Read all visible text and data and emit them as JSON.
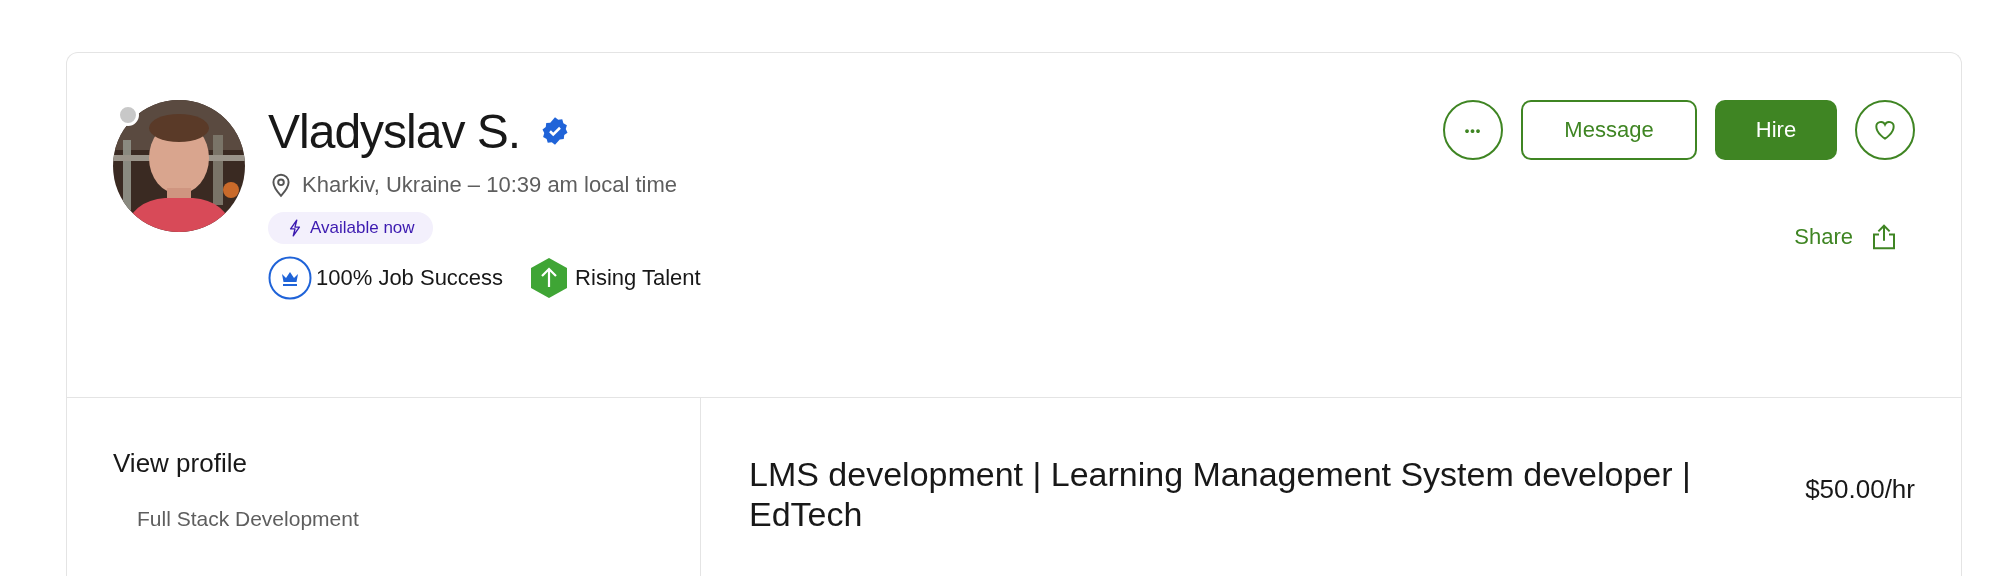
{
  "profile": {
    "name": "Vladyslav S.",
    "verified": true,
    "online": false,
    "location": "Kharkiv, Ukraine – 10:39 am local time",
    "availability": "Available now",
    "badges": [
      {
        "kind": "job_success",
        "label": "100% Job Success"
      },
      {
        "kind": "rising_talent",
        "label": "Rising Talent"
      }
    ]
  },
  "actions": {
    "more_label": "•••",
    "message": "Message",
    "hire": "Hire",
    "saved": false,
    "share": "Share"
  },
  "sidebar": {
    "title": "View profile",
    "items": [
      "Full Stack Development"
    ]
  },
  "listing": {
    "title": "LMS development | Learning Management System developer | EdTech",
    "rate": "$50.00/hr"
  }
}
